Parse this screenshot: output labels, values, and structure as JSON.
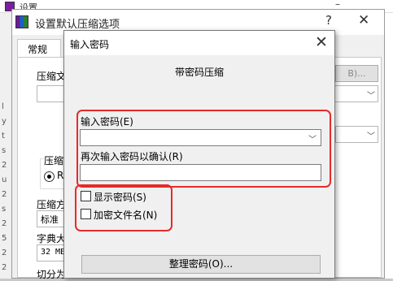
{
  "background_window": {
    "title": "设置",
    "minimize": "–",
    "left_edge_chars": [
      "l",
      "y",
      "t",
      "s",
      "2",
      "u",
      "2",
      "s",
      "2",
      "5",
      "2",
      "2",
      "4",
      "u",
      "h"
    ]
  },
  "settings_window": {
    "title": "设置默认压缩选项",
    "help_icon": "?",
    "close_icon": "✕",
    "tab_general": "常规",
    "labels": {
      "compress_file": "压缩文",
      "format": "压缩",
      "format_option": "RA",
      "method": "压缩方",
      "method_value": "标准",
      "dictionary": "字典大",
      "dictionary_value": "32 MB",
      "split": "切分为"
    },
    "browse_button": "B)..."
  },
  "password_dialog": {
    "title": "输入密码",
    "close_icon": "✕",
    "group_title": "带密码压缩",
    "enter_password_label": "输入密码(E)",
    "reenter_password_label": "再次输入密码以确认(R)",
    "password_value": "",
    "confirm_value": "",
    "show_password_label": "显示密码(S)",
    "show_password_checked": false,
    "encrypt_filenames_label": "加密文件名(N)",
    "encrypt_filenames_checked": false,
    "organize_button": "整理密码(O)..."
  },
  "colors": {
    "highlight": "#e52b2b",
    "dialog_bg": "#f0f0f0"
  }
}
